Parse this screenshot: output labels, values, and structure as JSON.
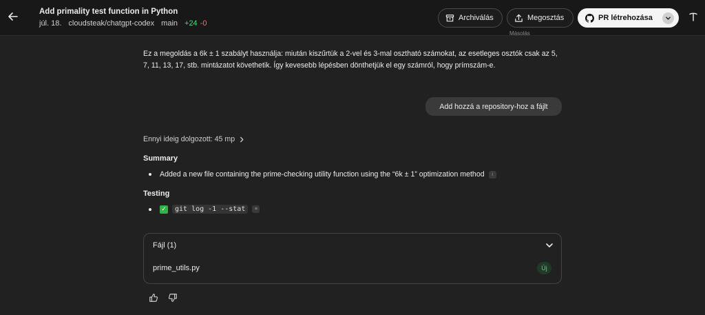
{
  "header": {
    "title": "Add primality test function in Python",
    "date": "júl. 18.",
    "repo": "cloudsteak/chatgpt-codex",
    "branch": "main",
    "additions": "+24",
    "deletions": "-0",
    "archive_label": "Archiválás",
    "share_label": "Megosztás",
    "pr_label": "PR létrehozása"
  },
  "conversation": {
    "peek_text": "Másolás",
    "answer_text": "Ez a megoldás a 6k ± 1 szabályt használja: miután kiszűrtük a 2-vel és 3-mal osztható számokat, az esetleges osztók csak az 5, 7, 11, 13, 17, stb. mintázatot követhetik. Így kevesebb lépésben dönthetjük el egy számról, hogy prímszám-e.",
    "user_message": "Add hozzá a repository-hoz a fájlt",
    "worked_label": "Ennyi ideig dolgozott: 45 mp",
    "summary_title": "Summary",
    "summary_item": "Added a new file containing the prime-checking utility function using the “6k ± 1” optimization method",
    "testing_title": "Testing",
    "testing_command": "git log -1 --stat"
  },
  "files": {
    "header": "Fájl (1)",
    "items": [
      {
        "name": "prime_utils.py",
        "badge": "Új"
      }
    ]
  },
  "colors": {
    "background": "#212121",
    "header_bg": "#181818",
    "additions": "#4ade80",
    "deletions": "#f87171",
    "check": "#2fb344"
  },
  "icons": [
    "arrow-left-icon",
    "archive-icon",
    "share-icon",
    "github-icon",
    "chevron-down-icon",
    "chevron-right-icon",
    "thumbs-up-icon",
    "thumbs-down-icon",
    "check-icon"
  ]
}
